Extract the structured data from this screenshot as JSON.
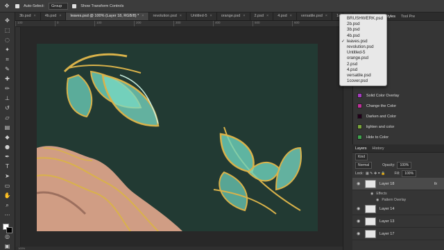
{
  "options_bar": {
    "auto_select_label": "Auto-Select:",
    "auto_select_value": "Group",
    "transform_label": "Show Transform Controls"
  },
  "tabs": [
    {
      "label": "3b.psd",
      "active": false
    },
    {
      "label": "4b.psd",
      "active": false
    },
    {
      "label": "leaves.psd @ 100% (Layer 18, RGB/8) *",
      "active": true
    },
    {
      "label": "revolution.psd",
      "active": false
    },
    {
      "label": "Untitled-5",
      "active": false
    },
    {
      "label": "orange.psd",
      "active": false
    },
    {
      "label": "2.psd",
      "active": false
    },
    {
      "label": "4.psd",
      "active": false
    },
    {
      "label": "versatile.psd",
      "active": false
    },
    {
      "label": "1cover.",
      "active": false
    }
  ],
  "ruler_marks": [
    "100",
    "0",
    "100",
    "200",
    "300",
    "400",
    "500",
    "600"
  ],
  "doc_menu": {
    "items": [
      {
        "label": "BRUSHWERK.psd",
        "checked": false
      },
      {
        "label": "2b.psd",
        "checked": false
      },
      {
        "label": "3b.psd",
        "checked": false
      },
      {
        "label": "4b.psd",
        "checked": false
      },
      {
        "label": "leaves.psd",
        "checked": true
      },
      {
        "label": "revolution.psd",
        "checked": false
      },
      {
        "label": "Untitled-5",
        "checked": false
      },
      {
        "label": "orange.psd",
        "checked": false
      },
      {
        "label": "2.psd",
        "checked": false
      },
      {
        "label": "4.psd",
        "checked": false
      },
      {
        "label": "versatile.psd",
        "checked": false
      },
      {
        "label": "1cover.psd",
        "checked": false
      }
    ]
  },
  "styles_panel": {
    "tabs": [
      "Styles",
      "Tool Pre"
    ],
    "items": [
      {
        "label": "Solid Color Overlay",
        "color": "#a53bbf"
      },
      {
        "label": "Change the Color",
        "color": "#c0309a"
      },
      {
        "label": "Darken and Color",
        "color": "#22001a"
      },
      {
        "label": "lighten and color",
        "color": "#7aa63a"
      },
      {
        "label": "Hide to Color",
        "color": "#3fa34d"
      }
    ]
  },
  "layers_panel": {
    "tabs": [
      "Layers",
      "History"
    ],
    "kind_label": "Kind",
    "blend_mode": "Normal",
    "opacity_label": "Opacity:",
    "opacity_value": "100%",
    "lock_label": "Lock:",
    "fill_label": "Fill:",
    "fill_value": "100%",
    "layers": [
      {
        "name": "Layer 18",
        "selected": true,
        "fx": "fx"
      },
      {
        "name": "Layer 14",
        "selected": false,
        "fx": ""
      },
      {
        "name": "Layer 13",
        "selected": false,
        "fx": ""
      },
      {
        "name": "Layer 17",
        "selected": false,
        "fx": ""
      }
    ],
    "effects_label": "Effects",
    "effect_name": "Pattern Overlay"
  },
  "status": {
    "zoom": "100%"
  },
  "colors": {
    "canvas": "#223a33",
    "teal": "#6fd3bd",
    "gold": "#d9b24a"
  }
}
